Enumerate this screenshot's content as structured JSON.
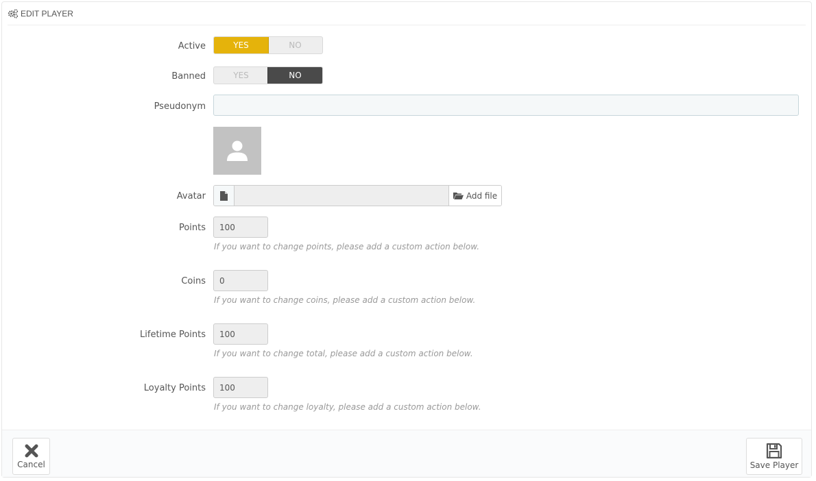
{
  "panel": {
    "title": "EDIT PLAYER",
    "icon": "cogs-icon"
  },
  "fields": {
    "active": {
      "label": "Active",
      "yes": "YES",
      "no": "NO",
      "value": "YES"
    },
    "banned": {
      "label": "Banned",
      "yes": "YES",
      "no": "NO",
      "value": "NO"
    },
    "pseudonym": {
      "label": "Pseudonym",
      "value": ""
    },
    "avatar": {
      "label": "Avatar",
      "file_value": "",
      "add_file": "Add file"
    },
    "points": {
      "label": "Points",
      "value": "100",
      "help": "If you want to change points, please add a custom action below."
    },
    "coins": {
      "label": "Coins",
      "value": "0",
      "help": "If you want to change coins, please add a custom action below."
    },
    "lifetime_points": {
      "label": "Lifetime Points",
      "value": "100",
      "help": "If you want to change total, please add a custom action below."
    },
    "loyalty_points": {
      "label": "Loyalty Points",
      "value": "100",
      "help": "If you want to change loyalty, please add a custom action below."
    }
  },
  "footer": {
    "cancel": "Cancel",
    "save": "Save Player"
  },
  "colors": {
    "switch_yes_active": "#e5b30b",
    "switch_no_active": "#4a4a4a",
    "avatar_placeholder": "#c2c2c2"
  }
}
